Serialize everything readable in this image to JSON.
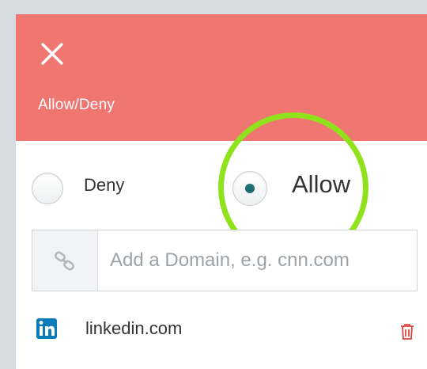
{
  "header": {
    "title": "Allow/Deny",
    "close_icon": "close-icon",
    "background_color": "#f07672"
  },
  "mode": {
    "options": [
      {
        "label": "Deny",
        "selected": false
      },
      {
        "label": "Allow",
        "selected": true
      }
    ],
    "selected_dot_color": "#1f6e73"
  },
  "domain_input": {
    "placeholder": "Add a Domain, e.g. cnn.com",
    "value": "",
    "icon": "link-icon"
  },
  "domains": [
    {
      "name": "linkedin.com",
      "icon": "linkedin-icon",
      "delete_icon": "trash-icon",
      "delete_color": "#e0463e"
    }
  ],
  "annotation": {
    "highlight_color": "#8fe21c"
  }
}
